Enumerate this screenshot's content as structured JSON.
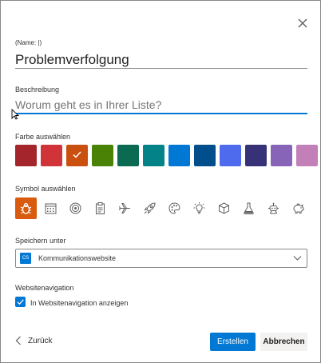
{
  "dialog": {
    "close_icon": "close-icon"
  },
  "name_field": {
    "label": "(Name: |)",
    "value": "Problemverfolgung"
  },
  "description_field": {
    "label": "Beschreibung",
    "placeholder": "Worum geht es in Ihrer Liste?"
  },
  "color_section": {
    "label": "Farbe auswählen",
    "selected_index": 2,
    "colors": [
      "#a4262c",
      "#d13438",
      "#ca5010",
      "#498205",
      "#0b6a52",
      "#038387",
      "#0078d4",
      "#004e8c",
      "#4f6bed",
      "#373277",
      "#8764b8",
      "#c27fb8"
    ]
  },
  "symbol_section": {
    "label": "Symbol auswählen",
    "selected_index": 0,
    "icons": [
      "bug-icon",
      "calendar-icon",
      "target-icon",
      "clipboard-icon",
      "airplane-icon",
      "rocket-icon",
      "palette-icon",
      "lightbulb-icon",
      "cube-icon",
      "flask-icon",
      "robot-icon",
      "piggy-bank-icon"
    ],
    "selected_color": "#d85b0f"
  },
  "save_section": {
    "label": "Speichern unter",
    "selected_value": "Kommunikationswebsite",
    "site_icon_text": "CS"
  },
  "navigation_section": {
    "label": "Websitenavigation",
    "checkbox_label": "In Websitenavigation anzeigen",
    "checked": true
  },
  "footer": {
    "back_label": "Zurück",
    "create_label": "Erstellen",
    "cancel_label": "Abbrechen"
  },
  "colors": {
    "accent": "#0078d4",
    "border": "#8a8886"
  }
}
